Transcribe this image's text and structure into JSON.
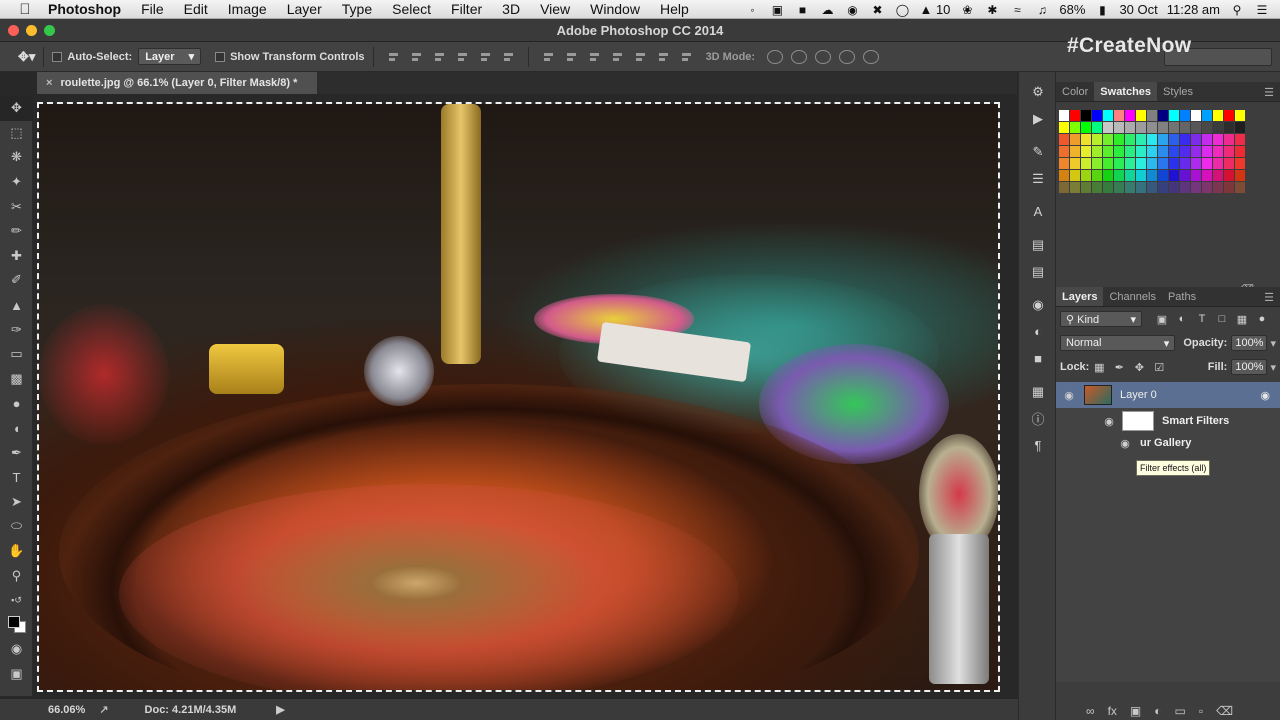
{
  "menubar": {
    "app_name": "Photoshop",
    "menus": [
      "File",
      "Edit",
      "Image",
      "Layer",
      "Type",
      "Select",
      "Filter",
      "3D",
      "View",
      "Window",
      "Help"
    ],
    "status": {
      "notification_count": "10",
      "battery": "68%",
      "date": "30 Oct",
      "time": "11:28 am"
    }
  },
  "window": {
    "title": "Adobe Photoshop CC 2014"
  },
  "options_bar": {
    "auto_select_label": "Auto-Select:",
    "auto_select_value": "Layer",
    "show_transform_label": "Show Transform Controls",
    "mode_3d_label": "3D Mode:"
  },
  "watermark": "#CreateNow",
  "document": {
    "tab_title": "roulette.jpg @ 66.1% (Layer 0, Filter Mask/8) *",
    "tab_close": "×"
  },
  "status_bar": {
    "zoom": "66.06%",
    "doc_size": "Doc: 4.21M/4.35M"
  },
  "swatches_panel": {
    "tabs": [
      "Color",
      "Swatches",
      "Styles"
    ],
    "active_tab": "Swatches"
  },
  "layers_panel": {
    "tabs": [
      "Layers",
      "Channels",
      "Paths"
    ],
    "active_tab": "Layers",
    "kind_filter": "Kind",
    "blend_mode": "Normal",
    "opacity_label": "Opacity:",
    "opacity_value": "100%",
    "lock_label": "Lock:",
    "fill_label": "Fill:",
    "fill_value": "100%",
    "layers": [
      {
        "name": "Layer 0"
      },
      {
        "name": "Smart Filters"
      },
      {
        "name": "ur Gallery"
      }
    ],
    "tooltip": "Filter effects (all)"
  },
  "colors": {
    "selected_layer": "#5a6f92",
    "panel_bg": "#3d3d3d",
    "canvas_bg": "#282828"
  }
}
